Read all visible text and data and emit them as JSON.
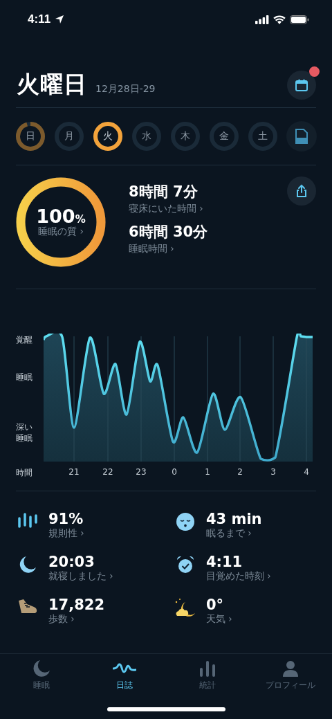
{
  "status_bar": {
    "time": "4:11"
  },
  "header": {
    "title": "火曜日",
    "date_range": "12月28日-29",
    "calendar_badge": true
  },
  "days": [
    {
      "label": "日",
      "level": 0.95,
      "selected": false
    },
    {
      "label": "月",
      "level": 0,
      "selected": false
    },
    {
      "label": "火",
      "level": 1,
      "selected": true
    },
    {
      "label": "水",
      "level": 0,
      "selected": false
    },
    {
      "label": "木",
      "level": 0,
      "selected": false
    },
    {
      "label": "金",
      "level": 0,
      "selected": false
    },
    {
      "label": "土",
      "level": 0,
      "selected": false
    }
  ],
  "summary": {
    "quality": {
      "value": "100",
      "unit": "%",
      "label": "睡眠の質 ›",
      "level": 1
    },
    "metrics": [
      {
        "value": "8時間 7分",
        "label": "寝床にいた時間 ›"
      },
      {
        "value": "6時間 30分",
        "label": "睡眠時間 ›"
      }
    ]
  },
  "sleep_graph": {
    "y_labels": [
      "覚醒",
      "睡眠",
      "深い睡眠"
    ],
    "x_title": "時間",
    "x_labels": [
      "21",
      "22",
      "23",
      "0",
      "1",
      "2",
      "3",
      "4"
    ]
  },
  "stats": [
    {
      "kind": "regularity",
      "value": "91%",
      "label": "規則性 ›"
    },
    {
      "kind": "fall-asleep",
      "value": "43 min",
      "label": "眠るまで ›"
    },
    {
      "kind": "bedtime",
      "value": "20:03",
      "label": "就寝しました ›"
    },
    {
      "kind": "wake",
      "value": "4:11",
      "label": "目覚めた時刻 ›"
    },
    {
      "kind": "steps",
      "value": "17,822",
      "label": "歩数 ›"
    },
    {
      "kind": "weather",
      "value": "0°",
      "label": "天気 ›"
    }
  ],
  "tabs": [
    {
      "kind": "sleep",
      "label": "睡眠",
      "selected": false
    },
    {
      "kind": "journal",
      "label": "日誌",
      "selected": true
    },
    {
      "kind": "stats",
      "label": "統計",
      "selected": false
    },
    {
      "kind": "profile",
      "label": "プロフィール",
      "selected": false
    }
  ]
}
